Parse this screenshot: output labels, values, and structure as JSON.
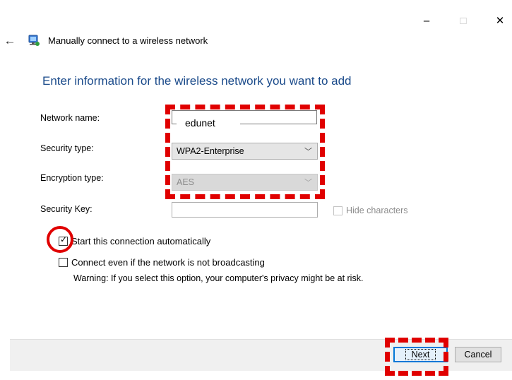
{
  "window": {
    "title": "Manually connect to a wireless network",
    "minimize_glyph": "–",
    "maximize_glyph": "□",
    "close_glyph": "✕",
    "back_glyph": "←"
  },
  "heading": "Enter information for the wireless network you want to add",
  "form": {
    "network_name": {
      "label": "Network name:",
      "value": "edunet"
    },
    "security_type": {
      "label": "Security type:",
      "value": "WPA2-Enterprise"
    },
    "encryption_type": {
      "label": "Encryption type:",
      "value": "AES"
    },
    "security_key": {
      "label": "Security Key:",
      "value": "",
      "hide_characters_label": "Hide characters",
      "hide_characters_checked": false
    }
  },
  "options": {
    "auto_connect": {
      "label": "Start this connection automatically",
      "checked": true,
      "check_glyph": "✓"
    },
    "broadcast": {
      "label": "Connect even if the network is not broadcasting",
      "checked": false
    },
    "warning": "Warning: If you select this option, your computer's privacy might be at risk."
  },
  "buttons": {
    "next": "Next",
    "cancel": "Cancel"
  },
  "colors": {
    "heading": "#1a4a8a",
    "annotation": "#e00000",
    "focus": "#0078d7"
  },
  "icons": {
    "select_chevron": "﹀"
  }
}
